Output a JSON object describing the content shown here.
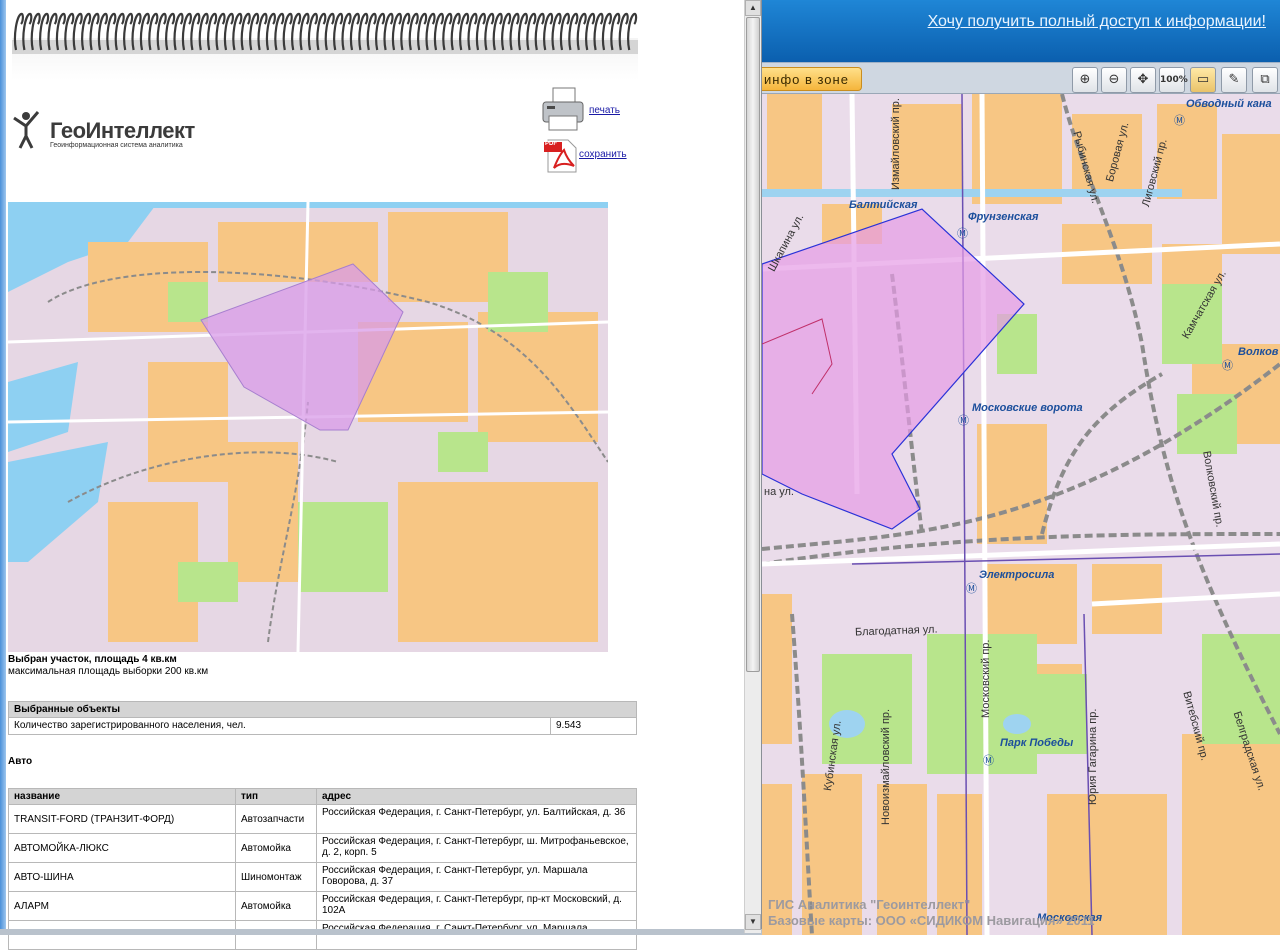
{
  "banner": {
    "link": "Хочу получить полный доступ к информации!"
  },
  "toolbar": {
    "zone_button": "инфо в зоне",
    "tools": [
      {
        "name": "zoom-in-icon",
        "glyph": "⊕"
      },
      {
        "name": "zoom-out-icon",
        "glyph": "⊖"
      },
      {
        "name": "pan-icon",
        "glyph": "✥"
      },
      {
        "name": "zoom-100-icon",
        "glyph": "100%"
      },
      {
        "name": "ruler-icon",
        "glyph": "▭"
      },
      {
        "name": "brush-icon",
        "glyph": "✎"
      },
      {
        "name": "fullscreen-icon",
        "glyph": "⧉"
      }
    ]
  },
  "map_labels": {
    "stations": [
      "Балтийская",
      "Фрунзенская",
      "Московские ворота",
      "Электросила",
      "Парк Победы",
      "Московская",
      "Волков",
      "Обводный кана"
    ],
    "streets": [
      "Измайловский пр.",
      "Боровая ул.",
      "Лиговский пр.",
      "Рыбинская ул.",
      "Шкапина ул.",
      "Камчатская ул.",
      "Волковский пр.",
      "Благодатная ул.",
      "Кубинская ул.",
      "Новоизмайловский пр.",
      "Московский пр.",
      "Юрия Гагарина пр.",
      "Витебский пр.",
      "Белградская ул.",
      "на ул."
    ],
    "metro_symbol": "Ⓜ"
  },
  "map_credits": {
    "line1": "ГИС Аналитика \"Геоинтеллект\"",
    "line2": "Базовые карты: ООО «СИДИКОМ Навигация» 2011"
  },
  "report": {
    "logo_title": "ГеоИнтеллект",
    "logo_subtitle": "Геоинформационная система аналитика",
    "print_label": "печать",
    "save_label": "сохранить",
    "pdf_badge": "PDF",
    "selected_area": "Выбран участок, площадь 4 кв.км",
    "max_area": "максимальная площадь выборки 200 кв.км",
    "objects_table": {
      "header": "Выбранные объекты",
      "rows": [
        {
          "label": "Количество зарегистрированного населения, чел.",
          "value": "9.543"
        }
      ]
    },
    "section_auto": "Авто",
    "auto_table": {
      "columns": [
        "название",
        "тип",
        "адрес"
      ],
      "rows": [
        {
          "name": "TRANSIT-FORD (ТРАНЗИТ-ФОРД)",
          "type": "Автозапчасти",
          "address": "Российская Федерация, г. Санкт-Петербург, ул. Балтийская, д. 36"
        },
        {
          "name": "АВТОМОЙКА-ЛЮКС",
          "type": "Автомойка",
          "address": "Российская Федерация, г. Санкт-Петербург, ш. Митрофаньевское, д. 2, корп. 5"
        },
        {
          "name": "АВТО-ШИНА",
          "type": "Шиномонтаж",
          "address": "Российская Федерация, г. Санкт-Петербург, ул. Маршала Говорова, д. 37"
        },
        {
          "name": "АЛАРМ",
          "type": "Автомойка",
          "address": "Российская Федерация, г. Санкт-Петербург, пр-кт Московский, д. 102А"
        },
        {
          "name": "",
          "type": "",
          "address": "Российская Федерация, г. Санкт-Петербург, ул. Маршала"
        }
      ]
    }
  },
  "colors": {
    "banner": "#1f86d6",
    "zone_button": "#f5b53c",
    "selection_fill": "#e59be6",
    "selection_stroke": "#2a32d8",
    "residential": "#f7c684",
    "park": "#b8e58c",
    "link": "#1a1aa6"
  }
}
